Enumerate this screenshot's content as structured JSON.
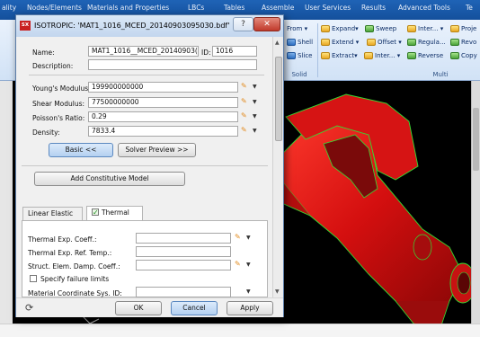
{
  "menubar": {
    "items": [
      "ality",
      "Nodes/Elements",
      "Materials and Properties",
      "LBCs",
      "Tables",
      "Assemble",
      "User Services",
      "Results",
      "Advanced Tools",
      "Te"
    ]
  },
  "ribbon": {
    "row1": [
      "From ▾",
      "Expand▾",
      "Sweep",
      "Inter... ▾",
      "Proje"
    ],
    "row2": [
      "Shell",
      "Extend ▾",
      "Offset ▾",
      "Regula...",
      "Revo"
    ],
    "row3": [
      "Slice",
      "Extract▾",
      "Inter... ▾",
      "Reverse",
      "Copy"
    ],
    "group_labels": [
      "Solid",
      "Multi"
    ]
  },
  "dialog": {
    "title": "ISOTROPIC: 'MAT1_1016_MCED_20140903095030.bdf'",
    "icon_text": "SX",
    "help_label": "?",
    "close_label": "✕",
    "name_label": "Name:",
    "name_value": "MAT1_1016__MCED_20140903(",
    "id_label": "ID:",
    "id_value": "1016",
    "description_label": "Description:",
    "description_value": "",
    "properties": [
      {
        "label": "Young's Modulus:",
        "value": "199900000000"
      },
      {
        "label": "Shear Modulus:",
        "value": "77500000000"
      },
      {
        "label": "Poisson's Ratio:",
        "value": "0.29"
      },
      {
        "label": "Density:",
        "value": "7833.4"
      }
    ],
    "basic_button": "Basic <<",
    "solver_preview_button": "Solver Preview >>",
    "add_model_button": "Add Constitutive Model",
    "tabs": [
      "Linear Elastic",
      "Thermal"
    ],
    "thermal_fields": [
      {
        "label": "Thermal Exp. Coeff.:",
        "value": ""
      },
      {
        "label": "Thermal Exp. Ref. Temp.:",
        "value": ""
      },
      {
        "label": "Struct. Elem. Damp. Coeff.:",
        "value": ""
      }
    ],
    "failure_label": "Specify failure limits",
    "coord_label": "Material Coordinate Sys. ID:",
    "coord_value": "",
    "ok_button": "OK",
    "cancel_button": "Cancel",
    "apply_button": "Apply"
  },
  "colors": {
    "menubar": "#1a5aa8",
    "model_red": "#e01818",
    "model_edges": "#33dd33",
    "viewport": "#000000"
  }
}
